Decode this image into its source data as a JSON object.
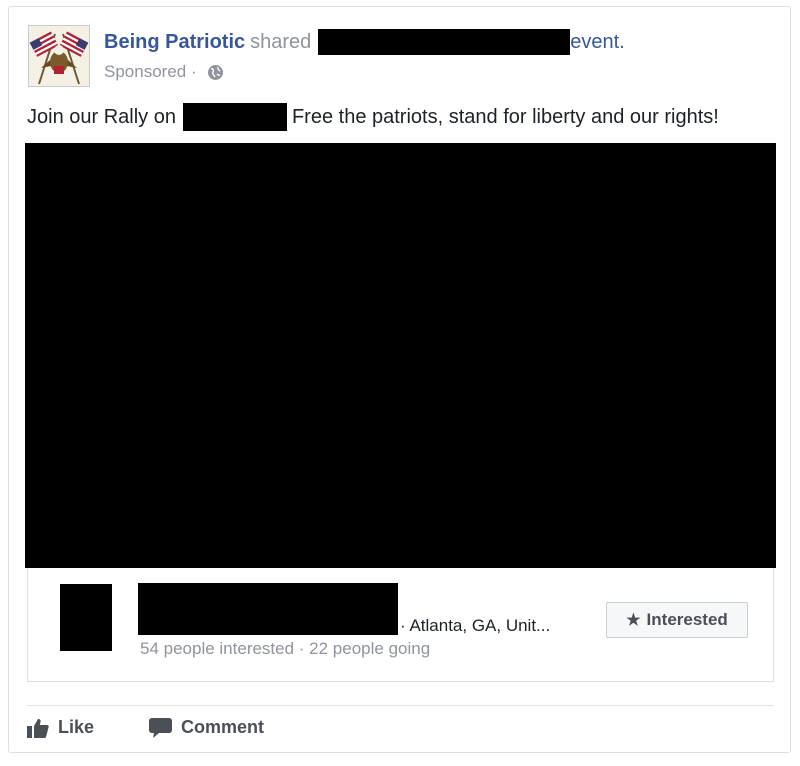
{
  "post": {
    "page_name": "Being Patriotic",
    "shared_text": "shared",
    "event_word": "event.",
    "sponsored": "Sponsored",
    "dot_separator": " · ",
    "text_before": "Join our Rally on",
    "text_after": "Free the patriots, stand for liberty and our rights!"
  },
  "event": {
    "location": "· Atlanta, GA, Unit...",
    "stats": "54 people interested · 22 people going",
    "interested_label": "Interested"
  },
  "actions": {
    "like_label": "Like",
    "comment_label": "Comment"
  },
  "icons": {
    "avatar": "american-flags-eagle-icon",
    "privacy": "globe-icon",
    "interested": "star-icon",
    "like": "thumbs-up-icon",
    "comment": "speech-bubble-icon"
  },
  "colors": {
    "link_blue": "#365899",
    "muted_gray": "#90949c",
    "text": "#1d2129",
    "button_text": "#4b4f56",
    "redaction": "#000000"
  }
}
